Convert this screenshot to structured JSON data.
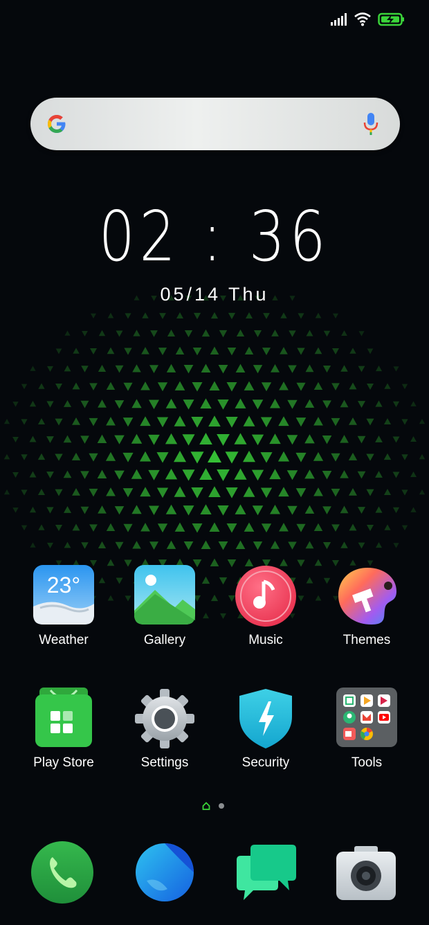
{
  "status": {
    "signal_icon": "signal-icon",
    "wifi_icon": "wifi-icon",
    "battery_icon": "battery-charging-icon"
  },
  "search": {
    "logo": "google-logo",
    "mic_icon": "microphone-icon"
  },
  "clock": {
    "time": "02 : 36",
    "date": "05/14  Thu"
  },
  "apps_row1": [
    {
      "label": "Weather",
      "temp": "23°"
    },
    {
      "label": "Gallery"
    },
    {
      "label": "Music"
    },
    {
      "label": "Themes"
    }
  ],
  "apps_row2": [
    {
      "label": "Play Store"
    },
    {
      "label": "Settings"
    },
    {
      "label": "Security"
    },
    {
      "label": "Tools"
    }
  ],
  "dock": [
    "phone-icon",
    "browser-icon",
    "messages-icon",
    "camera-icon"
  ],
  "colors": {
    "accent_green": "#3bd43a",
    "background": "#05080c"
  }
}
